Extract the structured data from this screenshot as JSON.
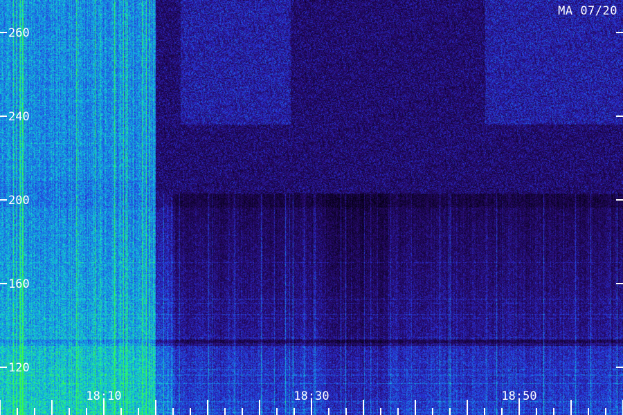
{
  "corner_label": "MA 07/20",
  "colors": {
    "background": "#000000",
    "low": "#1a0a4a",
    "mid": "#1f3fd8",
    "high": "#18c6d6",
    "peak": "#22ff4a",
    "axis": "#ffffff"
  },
  "chart_data": {
    "type": "heatmap",
    "title": "",
    "xlabel": "",
    "ylabel": "",
    "y_ticks": [
      "260",
      "240",
      "200",
      "160",
      "120"
    ],
    "x_ticks": [
      "18:10",
      "18:30",
      "18:50"
    ],
    "y_range": [
      110,
      270
    ],
    "notes": "Dynamic spectrogram; intense (green/cyan) emission at left before ~18:17, weaker blue vertical striations afterwards."
  }
}
